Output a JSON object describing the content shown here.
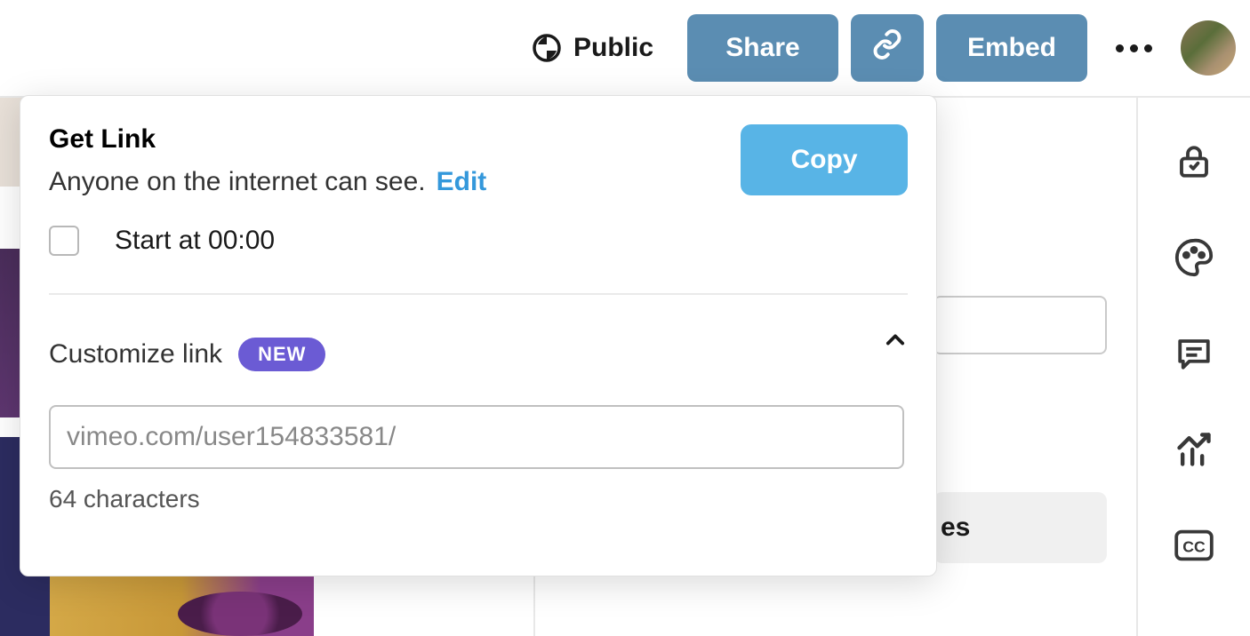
{
  "header": {
    "privacy_label": "Public",
    "share_label": "Share",
    "embed_label": "Embed"
  },
  "popover": {
    "title": "Get Link",
    "subtitle": "Anyone on the internet can see.",
    "edit_label": "Edit",
    "copy_label": "Copy",
    "start_at_label": "Start at 00:00",
    "customize_label": "Customize link",
    "new_badge": "NEW",
    "link_value": "vimeo.com/user154833581/",
    "char_count_label": "64 characters"
  },
  "bg": {
    "chip_text": "es"
  }
}
